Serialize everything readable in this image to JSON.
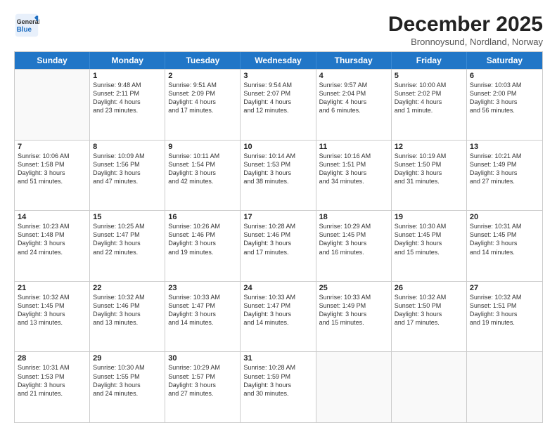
{
  "logo": {
    "line1": "General",
    "line2": "Blue"
  },
  "title": "December 2025",
  "subtitle": "Bronnoysund, Nordland, Norway",
  "header_days": [
    "Sunday",
    "Monday",
    "Tuesday",
    "Wednesday",
    "Thursday",
    "Friday",
    "Saturday"
  ],
  "rows": [
    [
      {
        "day": "",
        "info": ""
      },
      {
        "day": "1",
        "info": "Sunrise: 9:48 AM\nSunset: 2:11 PM\nDaylight: 4 hours\nand 23 minutes."
      },
      {
        "day": "2",
        "info": "Sunrise: 9:51 AM\nSunset: 2:09 PM\nDaylight: 4 hours\nand 17 minutes."
      },
      {
        "day": "3",
        "info": "Sunrise: 9:54 AM\nSunset: 2:07 PM\nDaylight: 4 hours\nand 12 minutes."
      },
      {
        "day": "4",
        "info": "Sunrise: 9:57 AM\nSunset: 2:04 PM\nDaylight: 4 hours\nand 6 minutes."
      },
      {
        "day": "5",
        "info": "Sunrise: 10:00 AM\nSunset: 2:02 PM\nDaylight: 4 hours\nand 1 minute."
      },
      {
        "day": "6",
        "info": "Sunrise: 10:03 AM\nSunset: 2:00 PM\nDaylight: 3 hours\nand 56 minutes."
      }
    ],
    [
      {
        "day": "7",
        "info": "Sunrise: 10:06 AM\nSunset: 1:58 PM\nDaylight: 3 hours\nand 51 minutes."
      },
      {
        "day": "8",
        "info": "Sunrise: 10:09 AM\nSunset: 1:56 PM\nDaylight: 3 hours\nand 47 minutes."
      },
      {
        "day": "9",
        "info": "Sunrise: 10:11 AM\nSunset: 1:54 PM\nDaylight: 3 hours\nand 42 minutes."
      },
      {
        "day": "10",
        "info": "Sunrise: 10:14 AM\nSunset: 1:53 PM\nDaylight: 3 hours\nand 38 minutes."
      },
      {
        "day": "11",
        "info": "Sunrise: 10:16 AM\nSunset: 1:51 PM\nDaylight: 3 hours\nand 34 minutes."
      },
      {
        "day": "12",
        "info": "Sunrise: 10:19 AM\nSunset: 1:50 PM\nDaylight: 3 hours\nand 31 minutes."
      },
      {
        "day": "13",
        "info": "Sunrise: 10:21 AM\nSunset: 1:49 PM\nDaylight: 3 hours\nand 27 minutes."
      }
    ],
    [
      {
        "day": "14",
        "info": "Sunrise: 10:23 AM\nSunset: 1:48 PM\nDaylight: 3 hours\nand 24 minutes."
      },
      {
        "day": "15",
        "info": "Sunrise: 10:25 AM\nSunset: 1:47 PM\nDaylight: 3 hours\nand 22 minutes."
      },
      {
        "day": "16",
        "info": "Sunrise: 10:26 AM\nSunset: 1:46 PM\nDaylight: 3 hours\nand 19 minutes."
      },
      {
        "day": "17",
        "info": "Sunrise: 10:28 AM\nSunset: 1:46 PM\nDaylight: 3 hours\nand 17 minutes."
      },
      {
        "day": "18",
        "info": "Sunrise: 10:29 AM\nSunset: 1:45 PM\nDaylight: 3 hours\nand 16 minutes."
      },
      {
        "day": "19",
        "info": "Sunrise: 10:30 AM\nSunset: 1:45 PM\nDaylight: 3 hours\nand 15 minutes."
      },
      {
        "day": "20",
        "info": "Sunrise: 10:31 AM\nSunset: 1:45 PM\nDaylight: 3 hours\nand 14 minutes."
      }
    ],
    [
      {
        "day": "21",
        "info": "Sunrise: 10:32 AM\nSunset: 1:45 PM\nDaylight: 3 hours\nand 13 minutes."
      },
      {
        "day": "22",
        "info": "Sunrise: 10:32 AM\nSunset: 1:46 PM\nDaylight: 3 hours\nand 13 minutes."
      },
      {
        "day": "23",
        "info": "Sunrise: 10:33 AM\nSunset: 1:47 PM\nDaylight: 3 hours\nand 14 minutes."
      },
      {
        "day": "24",
        "info": "Sunrise: 10:33 AM\nSunset: 1:47 PM\nDaylight: 3 hours\nand 14 minutes."
      },
      {
        "day": "25",
        "info": "Sunrise: 10:33 AM\nSunset: 1:49 PM\nDaylight: 3 hours\nand 15 minutes."
      },
      {
        "day": "26",
        "info": "Sunrise: 10:32 AM\nSunset: 1:50 PM\nDaylight: 3 hours\nand 17 minutes."
      },
      {
        "day": "27",
        "info": "Sunrise: 10:32 AM\nSunset: 1:51 PM\nDaylight: 3 hours\nand 19 minutes."
      }
    ],
    [
      {
        "day": "28",
        "info": "Sunrise: 10:31 AM\nSunset: 1:53 PM\nDaylight: 3 hours\nand 21 minutes."
      },
      {
        "day": "29",
        "info": "Sunrise: 10:30 AM\nSunset: 1:55 PM\nDaylight: 3 hours\nand 24 minutes."
      },
      {
        "day": "30",
        "info": "Sunrise: 10:29 AM\nSunset: 1:57 PM\nDaylight: 3 hours\nand 27 minutes."
      },
      {
        "day": "31",
        "info": "Sunrise: 10:28 AM\nSunset: 1:59 PM\nDaylight: 3 hours\nand 30 minutes."
      },
      {
        "day": "",
        "info": ""
      },
      {
        "day": "",
        "info": ""
      },
      {
        "day": "",
        "info": ""
      }
    ]
  ]
}
